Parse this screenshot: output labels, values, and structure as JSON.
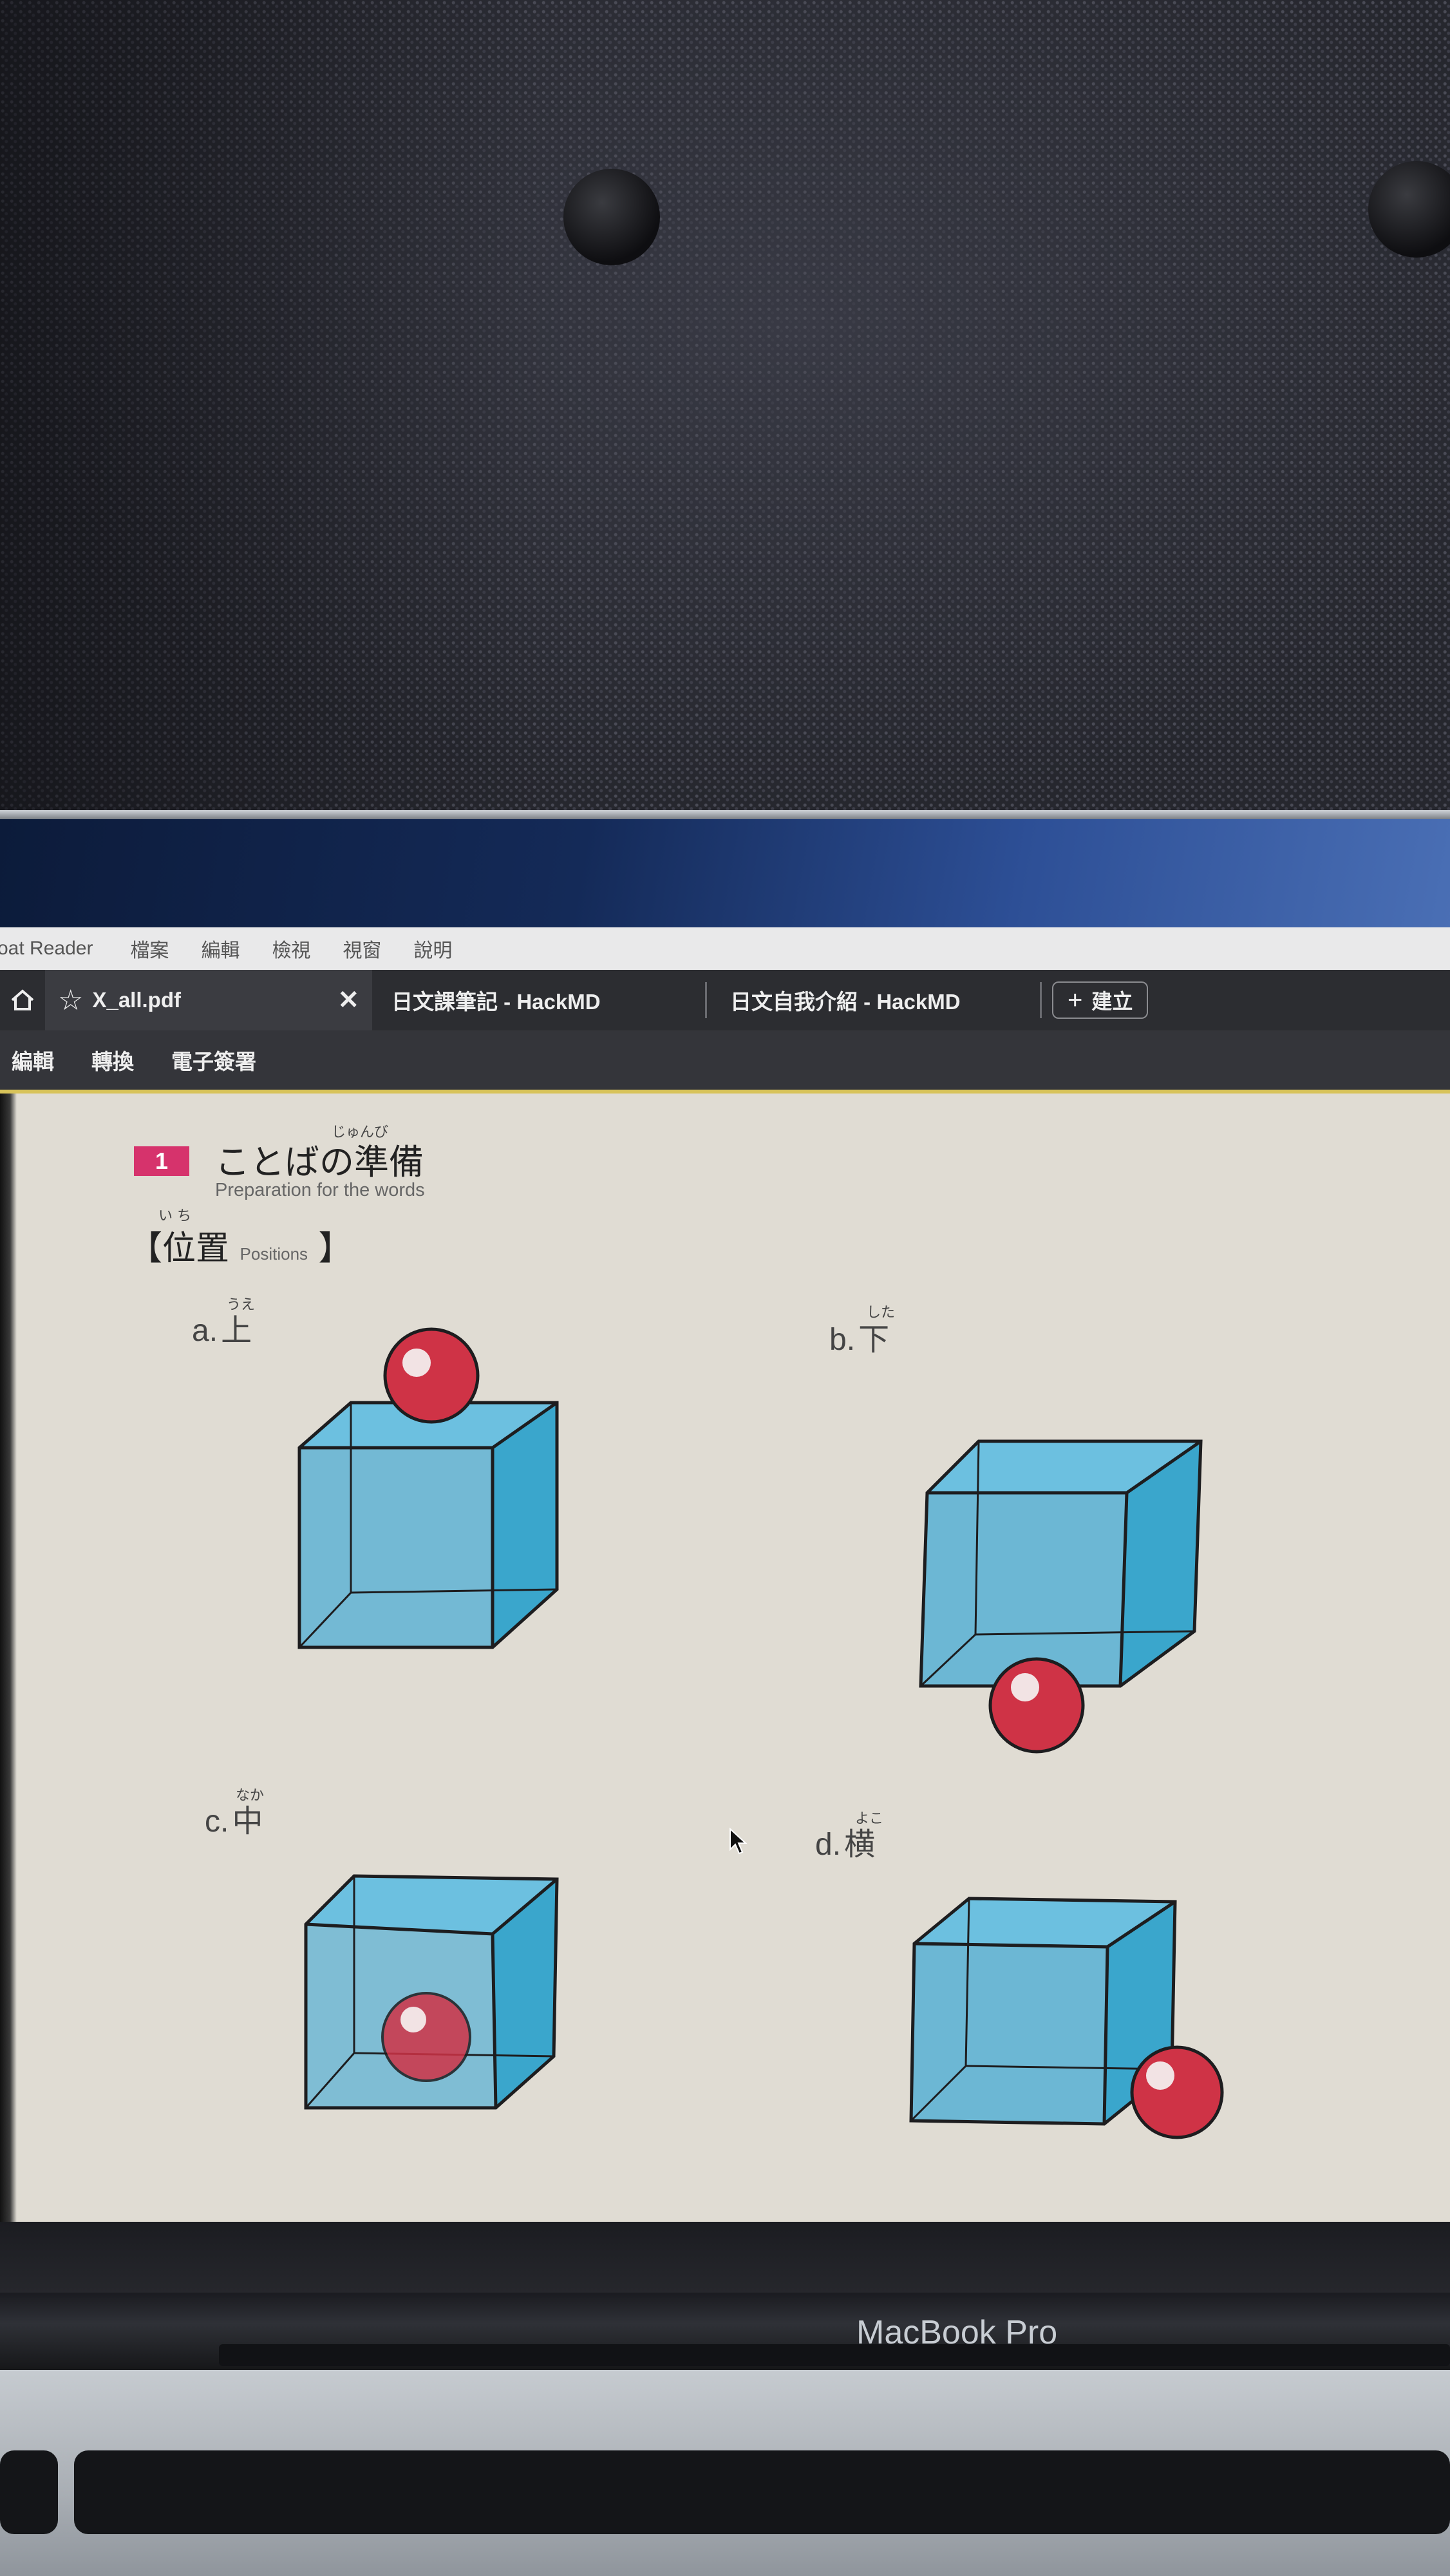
{
  "app": {
    "menubar": {
      "app_name": "oat Reader",
      "menus": [
        "檔案",
        "編輯",
        "檢視",
        "視窗",
        "說明"
      ]
    },
    "tabs": {
      "active": {
        "label": "X_all.pdf",
        "close_glyph": "✕"
      },
      "others": [
        {
          "label": "日文課筆記 - HackMD"
        },
        {
          "label": "日文自我介紹 - HackMD"
        }
      ],
      "new_tab_label": "建立"
    },
    "toolbar": {
      "tools": [
        "編輯",
        "轉換",
        "電子簽署"
      ]
    }
  },
  "document": {
    "section_number": "1",
    "section_title": "ことばの準備",
    "section_title_ruby": "じゅんび",
    "section_subtitle": "Preparation for the words",
    "positions_heading": "【位置",
    "positions_heading_ruby": "い ち",
    "positions_heading_en": "Positions",
    "positions_heading_close": "】",
    "items": [
      {
        "letter": "a.",
        "kanji": "上",
        "ruby": "うえ"
      },
      {
        "letter": "b.",
        "kanji": "下",
        "ruby": "した"
      },
      {
        "letter": "c.",
        "kanji": "中",
        "ruby": "なか"
      },
      {
        "letter": "d.",
        "kanji": "横",
        "ruby": "よこ"
      }
    ]
  },
  "hardware": {
    "brand": "MacBook Pro"
  },
  "colors": {
    "cube_fill": "#5fb3d4",
    "cube_edge": "#1d1d1f",
    "ball": "#cf3346",
    "badge": "#d6336c",
    "accent_line": "#d8c35a"
  }
}
